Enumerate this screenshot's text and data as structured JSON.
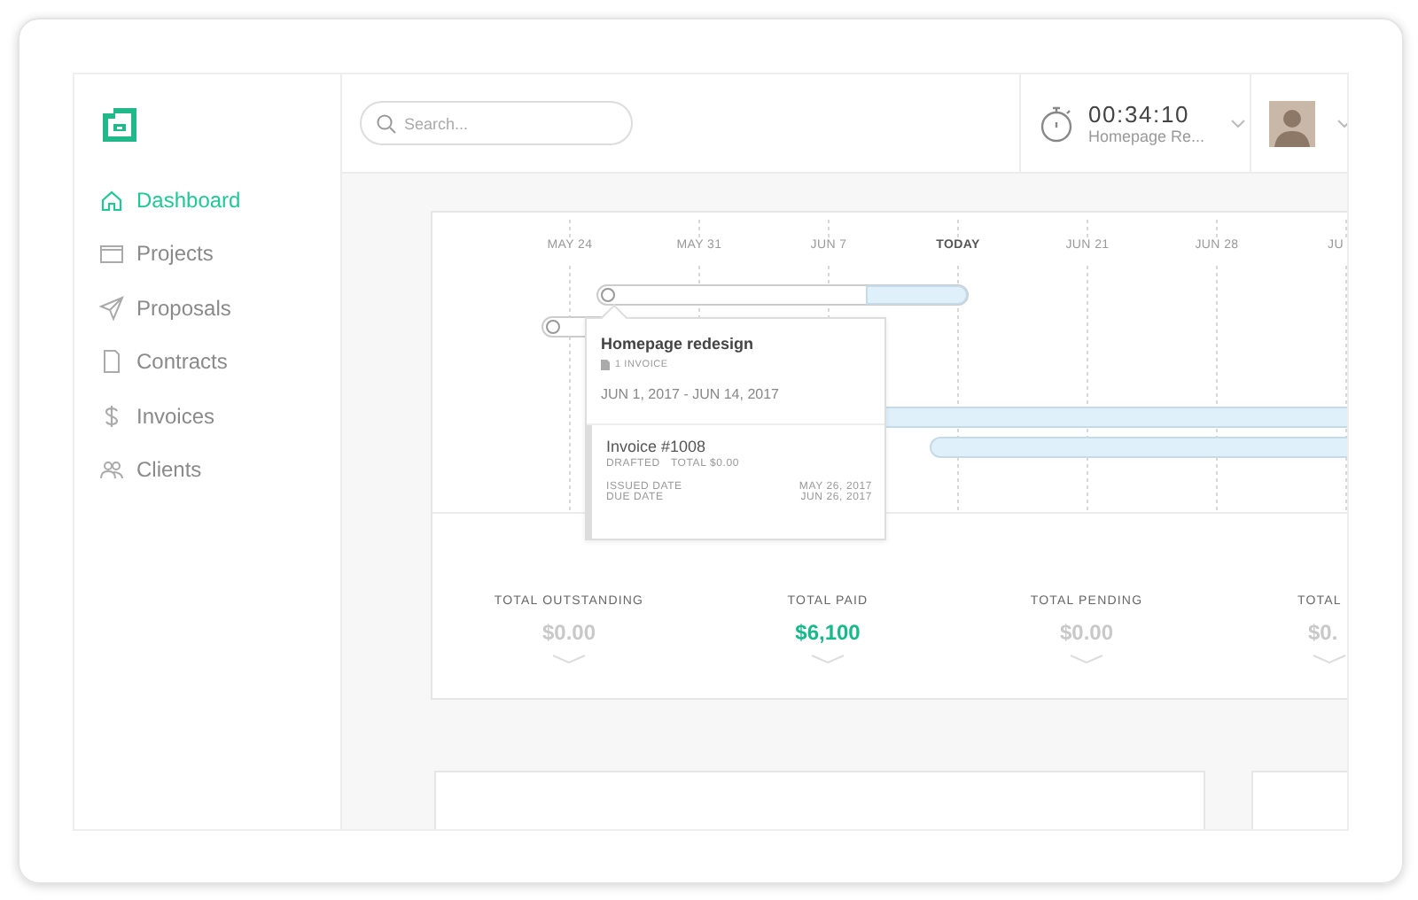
{
  "sidebar": {
    "items": [
      {
        "label": "Dashboard",
        "selected": true
      },
      {
        "label": "Projects",
        "selected": false
      },
      {
        "label": "Proposals",
        "selected": false
      },
      {
        "label": "Contracts",
        "selected": false
      },
      {
        "label": "Invoices",
        "selected": false
      },
      {
        "label": "Clients",
        "selected": false
      }
    ]
  },
  "header": {
    "search": {
      "placeholder": "Search..."
    },
    "timer": {
      "time": "00:34:10",
      "project": "Homepage Re..."
    }
  },
  "timeline": {
    "dates": [
      {
        "label": "MAY 24",
        "today": false
      },
      {
        "label": "MAY 31",
        "today": false
      },
      {
        "label": "JUN 7",
        "today": false
      },
      {
        "label": "TODAY",
        "today": true
      },
      {
        "label": "JUN 21",
        "today": false
      },
      {
        "label": "JUN 28",
        "today": false
      },
      {
        "label": "JU",
        "today": false
      }
    ],
    "popover": {
      "title": "Homepage redesign",
      "invoice_count": "1 INVOICE",
      "date_range": "JUN 1, 2017 - JUN 14, 2017",
      "invoice": {
        "number": "Invoice #1008",
        "status": "DRAFTED",
        "total": "TOTAL $0.00",
        "issued_label": "ISSUED DATE",
        "issued_date": "MAY 26, 2017",
        "due_label": "DUE DATE",
        "due_date": "JUN 26, 2017"
      }
    }
  },
  "totals": [
    {
      "label": "TOTAL OUTSTANDING",
      "value": "$0.00",
      "highlighted": false
    },
    {
      "label": "TOTAL PAID",
      "value": "$6,100",
      "highlighted": true
    },
    {
      "label": "TOTAL PENDING",
      "value": "$0.00",
      "highlighted": false
    },
    {
      "label": "TOTAL",
      "value": "$0.",
      "highlighted": false
    }
  ]
}
